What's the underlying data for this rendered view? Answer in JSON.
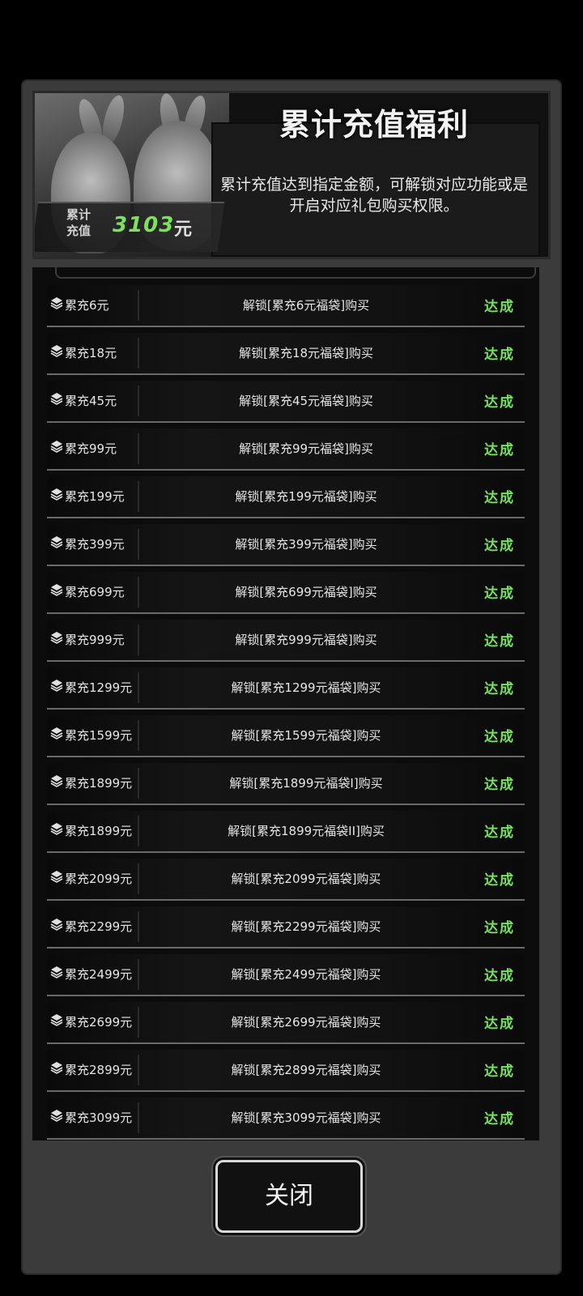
{
  "header": {
    "title": "累计充值福利",
    "description": "累计充值达到指定金额，可解锁对应功能或是开启对应礼包购买权限。",
    "total_caption_line1": "累计",
    "total_caption_line2": "充值",
    "total_value": "3103",
    "total_unit": "元"
  },
  "rows": [
    {
      "amount": "累充6元",
      "desc": "解锁[累充6元福袋]购买",
      "status": "达成"
    },
    {
      "amount": "累充18元",
      "desc": "解锁[累充18元福袋]购买",
      "status": "达成"
    },
    {
      "amount": "累充45元",
      "desc": "解锁[累充45元福袋]购买",
      "status": "达成"
    },
    {
      "amount": "累充99元",
      "desc": "解锁[累充99元福袋]购买",
      "status": "达成"
    },
    {
      "amount": "累充199元",
      "desc": "解锁[累充199元福袋]购买",
      "status": "达成"
    },
    {
      "amount": "累充399元",
      "desc": "解锁[累充399元福袋]购买",
      "status": "达成"
    },
    {
      "amount": "累充699元",
      "desc": "解锁[累充699元福袋]购买",
      "status": "达成"
    },
    {
      "amount": "累充999元",
      "desc": "解锁[累充999元福袋]购买",
      "status": "达成"
    },
    {
      "amount": "累充1299元",
      "desc": "解锁[累充1299元福袋]购买",
      "status": "达成"
    },
    {
      "amount": "累充1599元",
      "desc": "解锁[累充1599元福袋]购买",
      "status": "达成"
    },
    {
      "amount": "累充1899元",
      "desc": "解锁[累充1899元福袋I]购买",
      "status": "达成"
    },
    {
      "amount": "累充1899元",
      "desc": "解锁[累充1899元福袋II]购买",
      "status": "达成"
    },
    {
      "amount": "累充2099元",
      "desc": "解锁[累充2099元福袋]购买",
      "status": "达成"
    },
    {
      "amount": "累充2299元",
      "desc": "解锁[累充2299元福袋]购买",
      "status": "达成"
    },
    {
      "amount": "累充2499元",
      "desc": "解锁[累充2499元福袋]购买",
      "status": "达成"
    },
    {
      "amount": "累充2699元",
      "desc": "解锁[累充2699元福袋]购买",
      "status": "达成"
    },
    {
      "amount": "累充2899元",
      "desc": "解锁[累充2899元福袋]购买",
      "status": "达成"
    },
    {
      "amount": "累充3099元",
      "desc": "解锁[累充3099元福袋]购买",
      "status": "达成"
    }
  ],
  "row_icon": "layers-icon",
  "colors": {
    "status_achieved": "#78e060",
    "total_value": "#7fdf5f"
  },
  "close_button": {
    "label": "关闭"
  }
}
